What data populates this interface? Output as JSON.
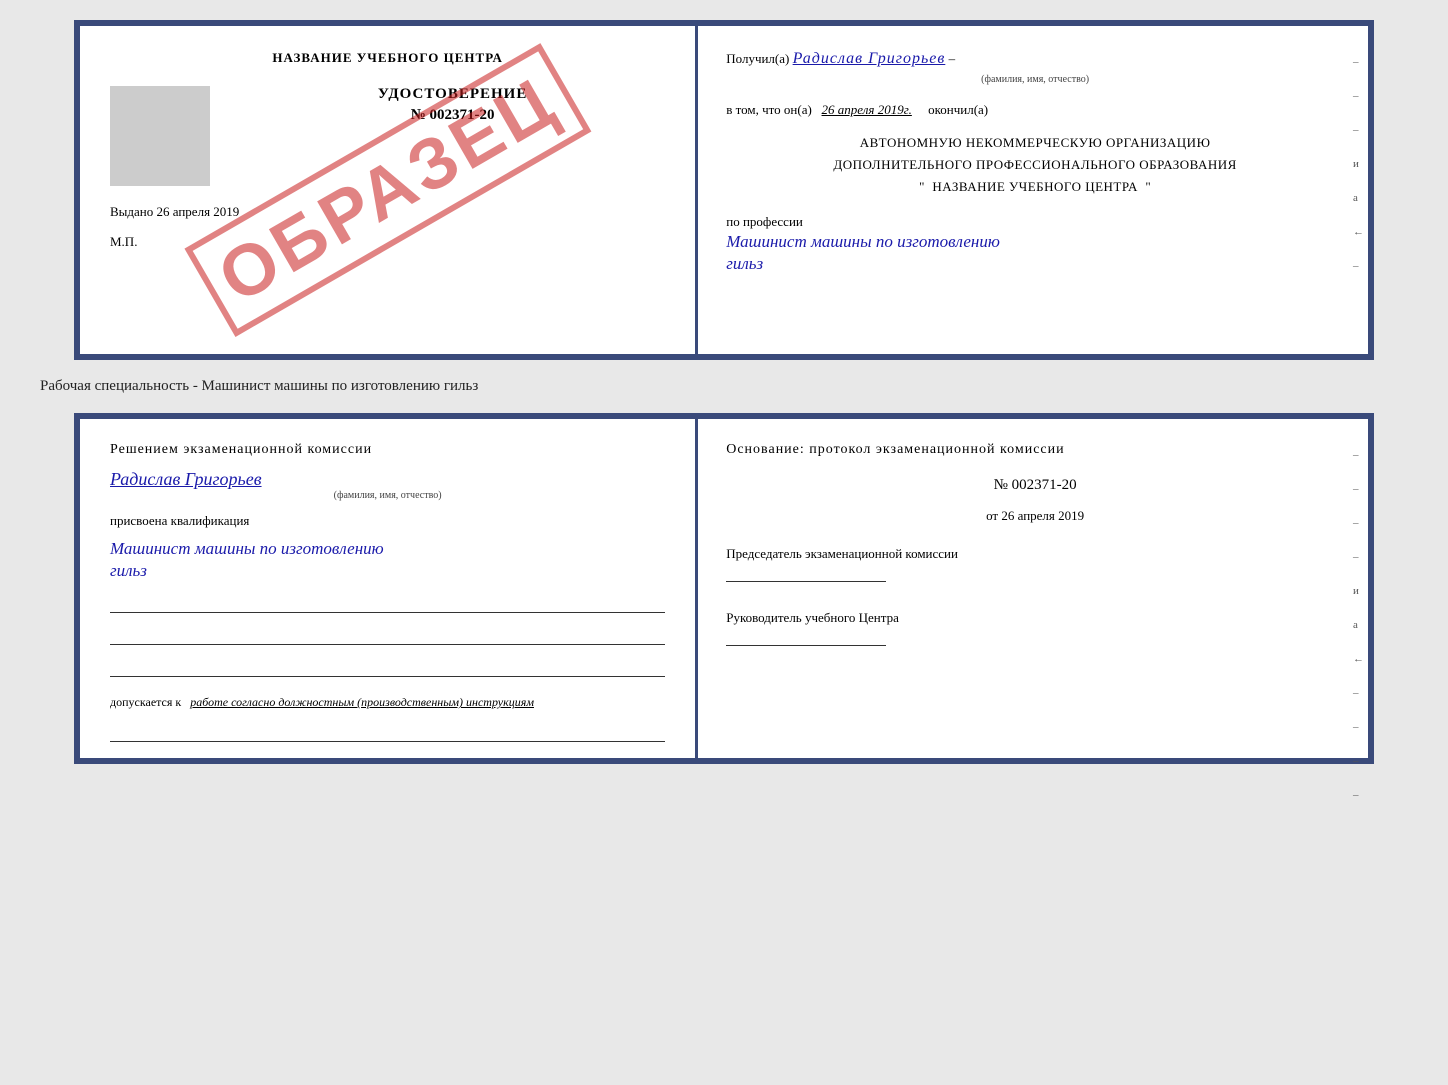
{
  "top_doc": {
    "left": {
      "school_name": "НАЗВАНИЕ УЧЕБНОГО ЦЕНТРА",
      "cert_title": "УДОСТОВЕРЕНИЕ",
      "cert_number": "№ 002371-20",
      "issued_label": "Выдано",
      "issued_date": "26 апреля 2019",
      "mp_label": "М.П.",
      "watermark": "ОБРАЗЕЦ"
    },
    "right": {
      "poluchil_label": "Получил(а)",
      "recipient_name": "Радислав Григорьев",
      "recipient_sub": "(фамилия, имя, отчество)",
      "dash": "–",
      "v_tom_label": "в том, что он(а)",
      "date_value": "26 апреля 2019г.",
      "okonchil_label": "окончил(а)",
      "org_line1": "АВТОНОМНУЮ НЕКОММЕРЧЕСКУЮ ОРГАНИЗАЦИЮ",
      "org_line2": "ДОПОЛНИТЕЛЬНОГО ПРОФЕССИОНАЛЬНОГО ОБРАЗОВАНИЯ",
      "org_quote": "\"",
      "school_name_right": "НАЗВАНИЕ УЧЕБНОГО ЦЕНТРА",
      "po_professii": "по профессии",
      "profession_value": "Машинист машины по изготовлению",
      "profession_line2": "гильз",
      "side_marks": [
        "–",
        "–",
        "–",
        "и",
        "а",
        "←",
        "–"
      ]
    }
  },
  "separator": {
    "text": "Рабочая специальность - Машинист машины по изготовлению гильз"
  },
  "bottom_doc": {
    "left": {
      "commission_text": "Решением  экзаменационной  комиссии",
      "person_name": "Радислав Григорьев",
      "name_sub": "(фамилия, имя, отчество)",
      "prisvoena_label": "присвоена квалификация",
      "qual_value": "Машинист машины по изготовлению",
      "qual_line2": "гильз",
      "dopusk_label": "допускается к",
      "dopusk_italic": "работе согласно должностным (производственным) инструкциям"
    },
    "right": {
      "osnov_title": "Основание: протокол экзаменационной  комиссии",
      "protocol_number": "№  002371-20",
      "protocol_date_prefix": "от",
      "protocol_date": "26 апреля 2019",
      "chairman_title": "Председатель экзаменационной комиссии",
      "rukov_title": "Руководитель учебного Центра",
      "side_marks": [
        "–",
        "–",
        "–",
        "–",
        "и",
        "а",
        "←",
        "–",
        "–",
        "–",
        "–"
      ]
    }
  }
}
